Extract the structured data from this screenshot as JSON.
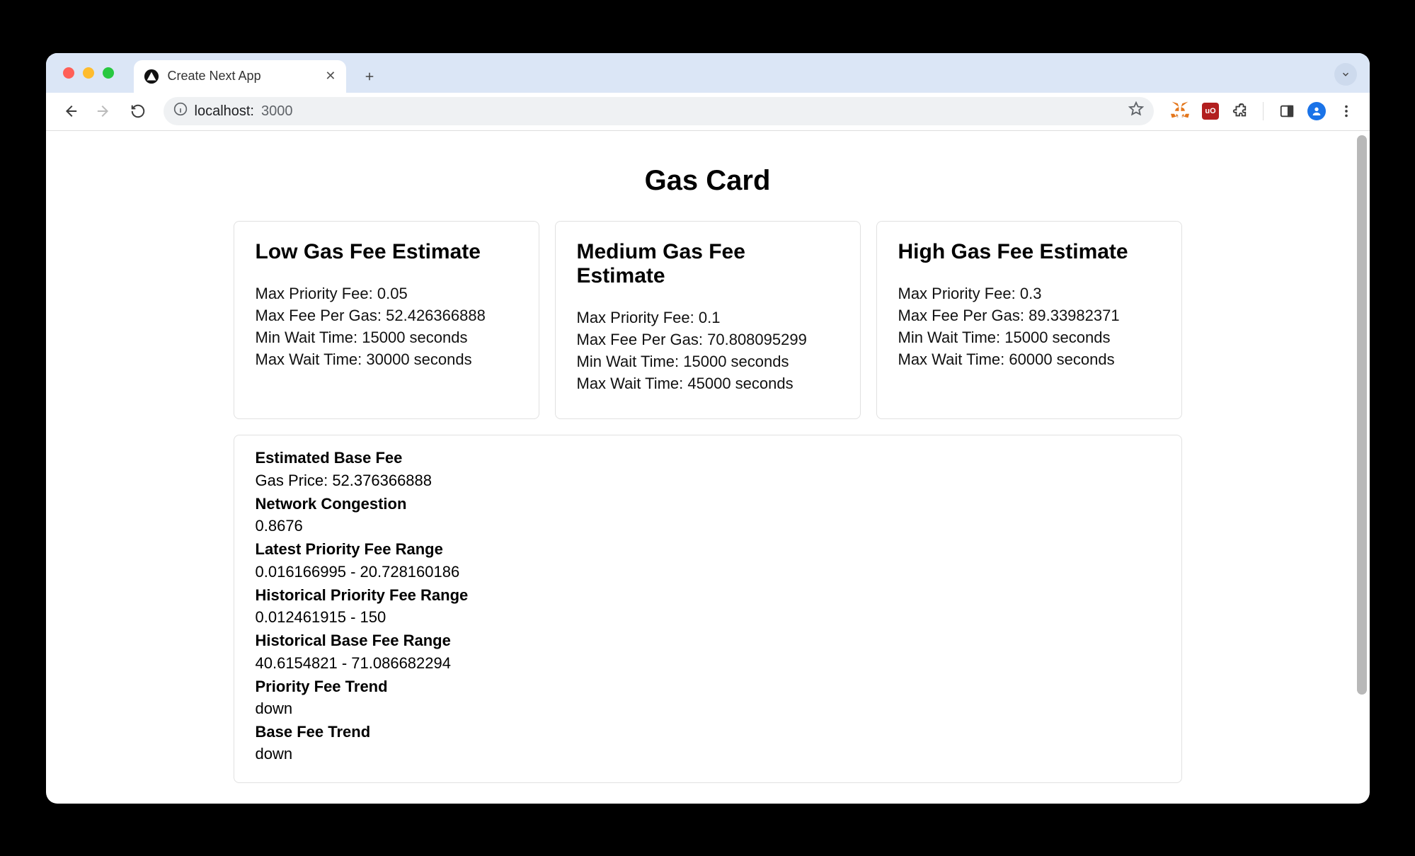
{
  "browser": {
    "tab_title": "Create Next App",
    "url_host": "localhost:",
    "url_path": "3000"
  },
  "page": {
    "title": "Gas Card",
    "estimates": [
      {
        "title": "Low Gas Fee Estimate",
        "max_priority_fee_label": "Max Priority Fee: ",
        "max_priority_fee": "0.05",
        "max_fee_per_gas_label": "Max Fee Per Gas: ",
        "max_fee_per_gas": "52.426366888",
        "min_wait_label": "Min Wait Time: ",
        "min_wait": "15000 seconds",
        "max_wait_label": "Max Wait Time: ",
        "max_wait": "30000 seconds"
      },
      {
        "title": "Medium Gas Fee Estimate",
        "max_priority_fee_label": "Max Priority Fee: ",
        "max_priority_fee": "0.1",
        "max_fee_per_gas_label": "Max Fee Per Gas: ",
        "max_fee_per_gas": "70.808095299",
        "min_wait_label": "Min Wait Time: ",
        "min_wait": "15000 seconds",
        "max_wait_label": "Max Wait Time: ",
        "max_wait": "45000 seconds"
      },
      {
        "title": "High Gas Fee Estimate",
        "max_priority_fee_label": "Max Priority Fee: ",
        "max_priority_fee": "0.3",
        "max_fee_per_gas_label": "Max Fee Per Gas: ",
        "max_fee_per_gas": "89.33982371",
        "min_wait_label": "Min Wait Time: ",
        "min_wait": "15000 seconds",
        "max_wait_label": "Max Wait Time: ",
        "max_wait": "60000 seconds"
      }
    ],
    "summary": {
      "estimated_base_fee_label": "Estimated Base Fee",
      "gas_price_label": "Gas Price: ",
      "gas_price": "52.376366888",
      "network_congestion_label": "Network Congestion",
      "network_congestion": "0.8676",
      "latest_priority_fee_range_label": "Latest Priority Fee Range",
      "latest_priority_fee_range": "0.016166995 - 20.728160186",
      "historical_priority_fee_range_label": "Historical Priority Fee Range",
      "historical_priority_fee_range": "0.012461915 - 150",
      "historical_base_fee_range_label": "Historical Base Fee Range",
      "historical_base_fee_range": "40.6154821 - 71.086682294",
      "priority_fee_trend_label": "Priority Fee Trend",
      "priority_fee_trend": "down",
      "base_fee_trend_label": "Base Fee Trend",
      "base_fee_trend": "down"
    }
  }
}
